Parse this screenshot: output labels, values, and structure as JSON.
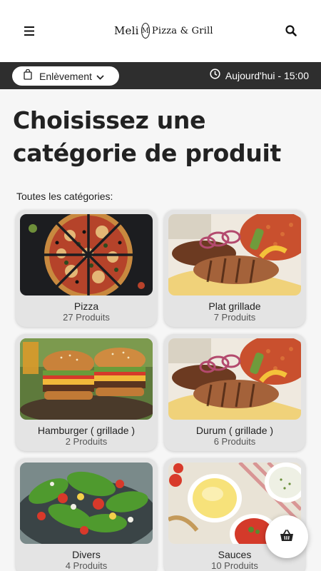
{
  "header": {
    "logo": {
      "name_part": "Meli",
      "badge_letter": "M",
      "suffix": "Pizza & Grill"
    },
    "menu_icon": "hamburger-menu-icon",
    "search_icon": "search-icon"
  },
  "order_bar": {
    "mode_label": "Enlèvement",
    "mode_icon": "shopping-bag-icon",
    "time_icon": "clock-icon",
    "time_label": "Aujourd'hui - 15:00"
  },
  "main": {
    "title": "Choisissez une catégorie de produit",
    "section_label": "Toutes les catégories:"
  },
  "categories": [
    {
      "name": "Pizza",
      "count": "27 Produits",
      "image": "pizza"
    },
    {
      "name": "Plat grillade",
      "count": "7 Produits",
      "image": "grill-plate"
    },
    {
      "name": "Hamburger ( grillade )",
      "count": "2 Produits",
      "image": "burgers"
    },
    {
      "name": "Durum ( grillade )",
      "count": "6 Produits",
      "image": "grill-plate"
    },
    {
      "name": "Divers",
      "count": "4 Produits",
      "image": "salad"
    },
    {
      "name": "Sauces",
      "count": "10 Produits",
      "image": "sauces"
    }
  ],
  "cart": {
    "icon": "basket-icon"
  },
  "colors": {
    "order_bar": "#2e2e2e",
    "card": "#e4e4e4",
    "background": "#f6f6f6"
  }
}
